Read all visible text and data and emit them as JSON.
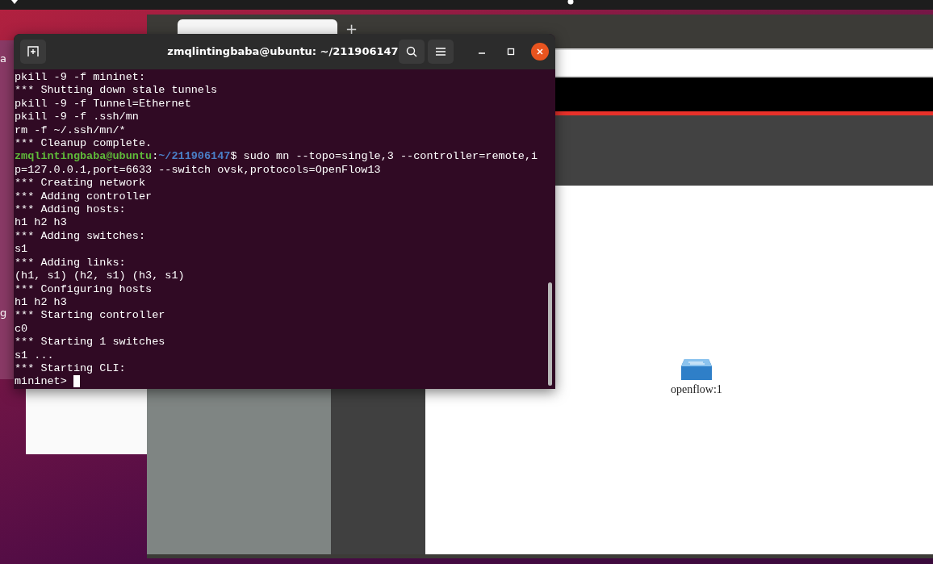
{
  "background_window": {
    "texts": [
      "a",
      "g"
    ]
  },
  "browser": {
    "tabs": [
      {
        "selected": true
      }
    ],
    "new_tab": "+",
    "topology": {
      "nodes": [
        {
          "label": "openflow:1"
        }
      ]
    }
  },
  "terminal": {
    "title": "zmqlintingbaba@ubuntu: ~/211906147",
    "lines": [
      {
        "kind": "output",
        "text": "pkill -9 -f mininet:"
      },
      {
        "kind": "output",
        "text": "*** Shutting down stale tunnels"
      },
      {
        "kind": "output",
        "text": "pkill -9 -f Tunnel=Ethernet"
      },
      {
        "kind": "output",
        "text": "pkill -9 -f .ssh/mn"
      },
      {
        "kind": "output",
        "text": "rm -f ~/.ssh/mn/*"
      },
      {
        "kind": "output",
        "text": "*** Cleanup complete."
      },
      {
        "kind": "prompt",
        "user": "zmqlintingbaba@ubuntu",
        "sep": ":",
        "path": "~/211906147",
        "text": "$ sudo mn --topo=single,3 --controller=remote,ip=127.0.0.1,port=6633 --switch ovsk,protocols=OpenFlow13"
      },
      {
        "kind": "output",
        "text": "*** Creating network"
      },
      {
        "kind": "output",
        "text": "*** Adding controller"
      },
      {
        "kind": "output",
        "text": "*** Adding hosts:"
      },
      {
        "kind": "output",
        "text": "h1 h2 h3"
      },
      {
        "kind": "output",
        "text": "*** Adding switches:"
      },
      {
        "kind": "output",
        "text": "s1"
      },
      {
        "kind": "output",
        "text": "*** Adding links:"
      },
      {
        "kind": "output",
        "text": "(h1, s1) (h2, s1) (h3, s1)"
      },
      {
        "kind": "output",
        "text": "*** Configuring hosts"
      },
      {
        "kind": "output",
        "text": "h1 h2 h3"
      },
      {
        "kind": "output",
        "text": "*** Starting controller"
      },
      {
        "kind": "output",
        "text": "c0"
      },
      {
        "kind": "output",
        "text": "*** Starting 1 switches"
      },
      {
        "kind": "output",
        "text": "s1 ..."
      },
      {
        "kind": "output",
        "text": "*** Starting CLI:"
      },
      {
        "kind": "input",
        "text": "mininet> "
      }
    ]
  }
}
